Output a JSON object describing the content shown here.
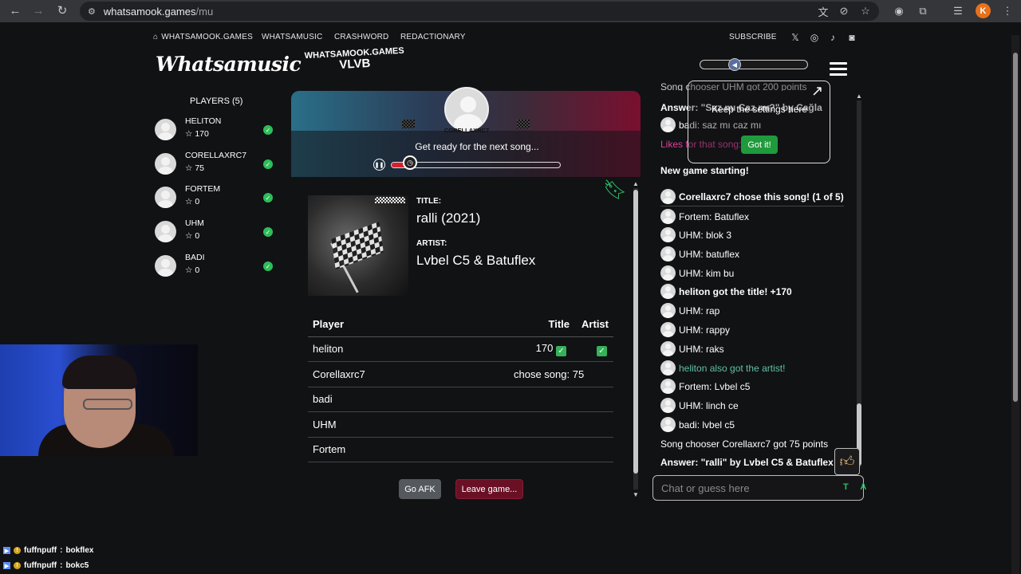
{
  "browser": {
    "url_host": "whatsamook.games",
    "url_path": "/mu",
    "profile_initial": "K"
  },
  "topnav": {
    "home": "WHATSAMOOK.GAMES",
    "whatsamusic": "WHATSAMUSIC",
    "crashword": "CRASHWORD",
    "redactionary": "REDACTIONARY",
    "subscribe": "SUBSCRIBE"
  },
  "logo": "Whatsamusic",
  "room": {
    "site": "WHATSAMOOK.GAMES",
    "code": "VLVB"
  },
  "players": {
    "heading": "PLAYERS (5)",
    "list": [
      {
        "name": "HELITON",
        "score": "170"
      },
      {
        "name": "CORELLAXRC7",
        "score": "75"
      },
      {
        "name": "FORTEM",
        "score": "0"
      },
      {
        "name": "UHM",
        "score": "0"
      },
      {
        "name": "BADI",
        "score": "0"
      }
    ]
  },
  "song": {
    "chooser": "CORELLAXRC7",
    "status": "Get ready for the next song...",
    "progress": 0.11,
    "title_label": "TITLE:",
    "title": "ralli (2021)",
    "artist_label": "ARTIST:",
    "artist": "Lvbel C5 & Batuflex"
  },
  "results": {
    "headers": {
      "player": "Player",
      "title": "Title",
      "artist": "Artist"
    },
    "rows": [
      {
        "player": "heliton",
        "title": "170"
      },
      {
        "player": "Corellaxrc7",
        "title": "chose song: 75"
      },
      {
        "player": "badi",
        "title": ""
      },
      {
        "player": "UHM",
        "title": ""
      },
      {
        "player": "Fortem",
        "title": ""
      }
    ]
  },
  "buttons": {
    "afk": "Go AFK",
    "leave": "Leave game..."
  },
  "chat": {
    "top_partial": "Song chooser UHM got 200 points",
    "answer1": "Answer: \"Saz mı Caz mı?\" by Cağla",
    "m_badi1": "badi: saz mı caz mı",
    "likes": "Likes for that song:",
    "new_game": "New game starting!",
    "m_chose": "Corellaxrc7 chose this song! (1 of 5)",
    "m1": "Fortem: Batuflex",
    "m2": "UHM: blok 3",
    "m3": "UHM: batuflex",
    "m4": "UHM: kim bu",
    "m5": "heliton got the title! +170",
    "m6": "UHM: rap",
    "m7": "UHM: rappy",
    "m8": "UHM: raks",
    "m9": "heliton also got the artist!",
    "m10": "Fortem: Lvbel c5",
    "m11": "UHM: linch ce",
    "m12": "badi: lvbel c5",
    "points": "Song chooser Corellaxrc7 got 75 points",
    "answer2": "Answer: \"ralli\" by Lvbel C5 & Batuflex",
    "input_placeholder": "Chat or guess here",
    "tools": "T A"
  },
  "tooltip": {
    "text": "Keep the settings here",
    "button": "Got it!"
  },
  "twitch": [
    {
      "user": "fuffnpuff",
      "msg": "bokflex"
    },
    {
      "user": "fuffnpuff",
      "msg": "bokc5"
    }
  ],
  "colors": {
    "accent_green": "#2ebd59",
    "leave_red": "#6a1025",
    "progress_red": "#d42130"
  }
}
